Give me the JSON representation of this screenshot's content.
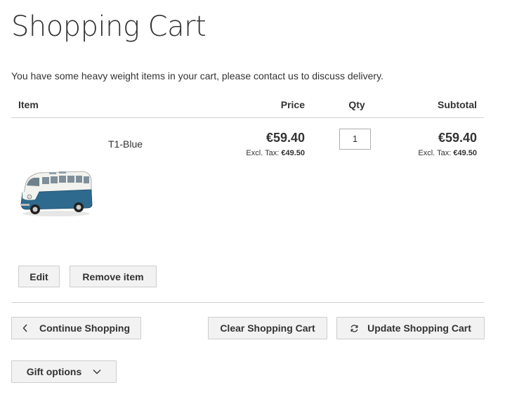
{
  "page": {
    "title": "Shopping Cart"
  },
  "notice": "You have some heavy weight items in your cart, please contact us to discuss delivery.",
  "table": {
    "headers": {
      "item": "Item",
      "price": "Price",
      "qty": "Qty",
      "subtotal": "Subtotal"
    }
  },
  "cart_item": {
    "name": "T1-Blue",
    "image_icon": "vw-bus-image",
    "price": "€59.40",
    "price_excl_label": "Excl. Tax:",
    "price_excl_value": "€49.50",
    "qty": "1",
    "subtotal": "€59.40",
    "subtotal_excl_label": "Excl. Tax:",
    "subtotal_excl_value": "€49.50",
    "edit_label": "Edit",
    "remove_label": "Remove item"
  },
  "actions": {
    "continue_label": "Continue Shopping",
    "clear_label": "Clear Shopping Cart",
    "update_label": "Update Shopping Cart",
    "gift_label": "Gift options"
  },
  "colors": {
    "text": "#333333",
    "button_bg": "#f2f2f2",
    "border": "#cdcdcd",
    "bus_blue": "#2e6a8e"
  }
}
